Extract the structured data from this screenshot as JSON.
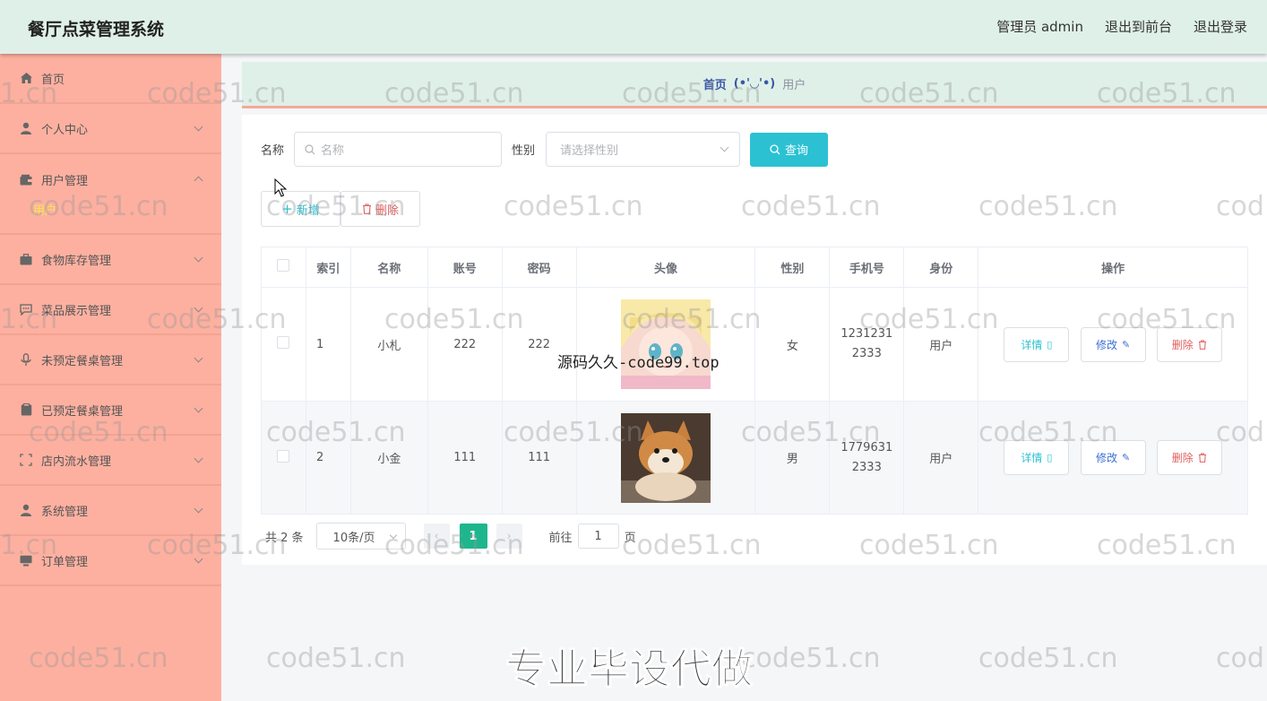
{
  "header": {
    "title": "餐厅点菜管理系统",
    "admin_label": "管理员 admin",
    "front_label": "退出到前台",
    "logout_label": "退出登录"
  },
  "sidebar": {
    "items": [
      {
        "label": "首页",
        "icon": "home-icon"
      },
      {
        "label": "个人中心",
        "icon": "user-icon"
      },
      {
        "label": "用户管理",
        "icon": "wallet-icon",
        "sub": "用户"
      },
      {
        "label": "食物库存管理",
        "icon": "briefcase-icon"
      },
      {
        "label": "菜品展示管理",
        "icon": "chat-icon"
      },
      {
        "label": "未预定餐桌管理",
        "icon": "mic-icon"
      },
      {
        "label": "已预定餐桌管理",
        "icon": "clipboard-icon"
      },
      {
        "label": "店内流水管理",
        "icon": "scan-icon"
      },
      {
        "label": "系统管理",
        "icon": "person-icon"
      },
      {
        "label": "订单管理",
        "icon": "monitor-icon"
      }
    ]
  },
  "breadcrumb": {
    "home": "首页",
    "sep": "(•'◡'•)",
    "current": "用户"
  },
  "search": {
    "name_label": "名称",
    "name_placeholder": "名称",
    "gender_label": "性别",
    "gender_placeholder": "请选择性别",
    "query_label": "查询"
  },
  "actions": {
    "add_label": "新增",
    "delete_label": "删除"
  },
  "table": {
    "columns": [
      "索引",
      "名称",
      "账号",
      "密码",
      "头像",
      "性别",
      "手机号",
      "身份",
      "操作"
    ],
    "rows": [
      {
        "index": "1",
        "name": "小札",
        "account": "222",
        "password": "222",
        "gender": "女",
        "phone1": "1231231",
        "phone2": "2333",
        "role": "用户"
      },
      {
        "index": "2",
        "name": "小金",
        "account": "111",
        "password": "111",
        "gender": "男",
        "phone1": "1779631",
        "phone2": "2333",
        "role": "用户"
      }
    ],
    "detail_label": "详情",
    "edit_label": "修改",
    "delete_label": "删除"
  },
  "pager": {
    "total": "共 2 条",
    "page_size": "10条/页",
    "current_page": "1",
    "goto_prefix": "前往",
    "goto_value": "1",
    "goto_suffix": "页"
  },
  "overlays": {
    "watermark": "code51.cn",
    "watermark_partial_left": "1.cn",
    "watermark_partial_right": "cod",
    "image_caption": "源码久久-code99.top",
    "promo": "专业毕设代做"
  }
}
